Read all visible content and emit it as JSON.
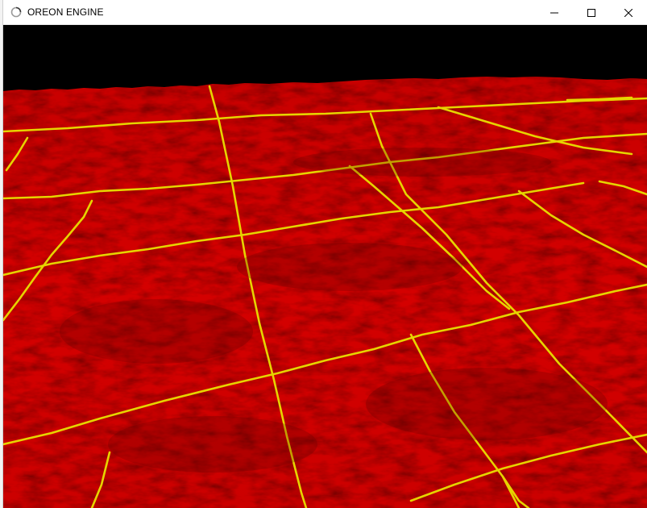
{
  "window": {
    "title": "OREON ENGINE",
    "icon": "loading-ring-icon",
    "controls": [
      "minimize-icon",
      "maximize-icon",
      "close-icon"
    ]
  },
  "scene": {
    "description_visible": false,
    "sky_color": "#000000",
    "terrain_color": "#d00000",
    "terrain_shadow_color": "#7a0000",
    "grid_line_color": "#e0d000"
  }
}
